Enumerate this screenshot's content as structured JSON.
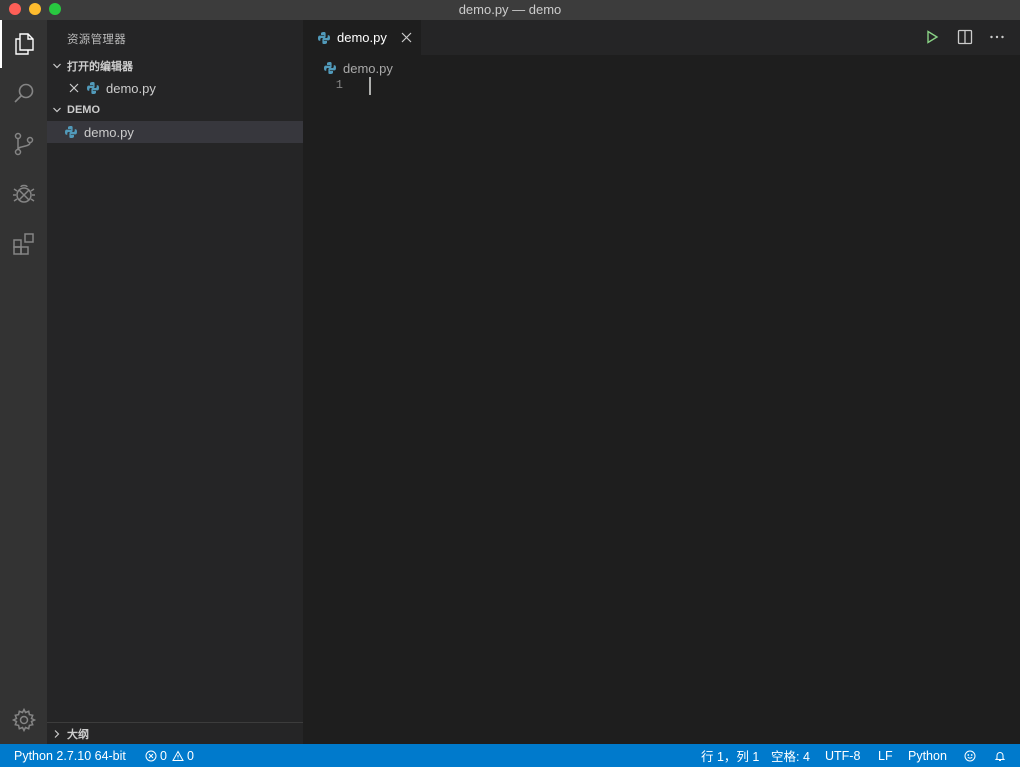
{
  "window": {
    "title": "demo.py — demo"
  },
  "activity_bar": {
    "items": [
      {
        "icon": "files-icon",
        "active": true
      },
      {
        "icon": "search-icon",
        "active": false
      },
      {
        "icon": "source-control-icon",
        "active": false
      },
      {
        "icon": "debug-icon",
        "active": false
      },
      {
        "icon": "extensions-icon",
        "active": false
      }
    ],
    "bottom_icon": "gear-icon"
  },
  "sidebar": {
    "title": "资源管理器",
    "open_editors": {
      "label": "打开的编辑器",
      "files": [
        {
          "name": "demo.py"
        }
      ]
    },
    "folder": {
      "label": "DEMO",
      "files": [
        {
          "name": "demo.py",
          "selected": true
        }
      ]
    },
    "outline_label": "大纲"
  },
  "editor": {
    "tab": {
      "label": "demo.py",
      "active": true
    },
    "breadcrumb": "demo.py",
    "line_numbers": [
      "1"
    ],
    "content": ""
  },
  "statusbar": {
    "interpreter": "Python 2.7.10 64-bit",
    "errors": "0",
    "warnings": "0",
    "position": "行 1，列 1",
    "indent": "空格: 4",
    "encoding": "UTF-8",
    "eol": "LF",
    "language": "Python"
  },
  "colors": {
    "accent": "#007acc",
    "run_icon": "#89d185",
    "python_blue": "#519aba"
  }
}
